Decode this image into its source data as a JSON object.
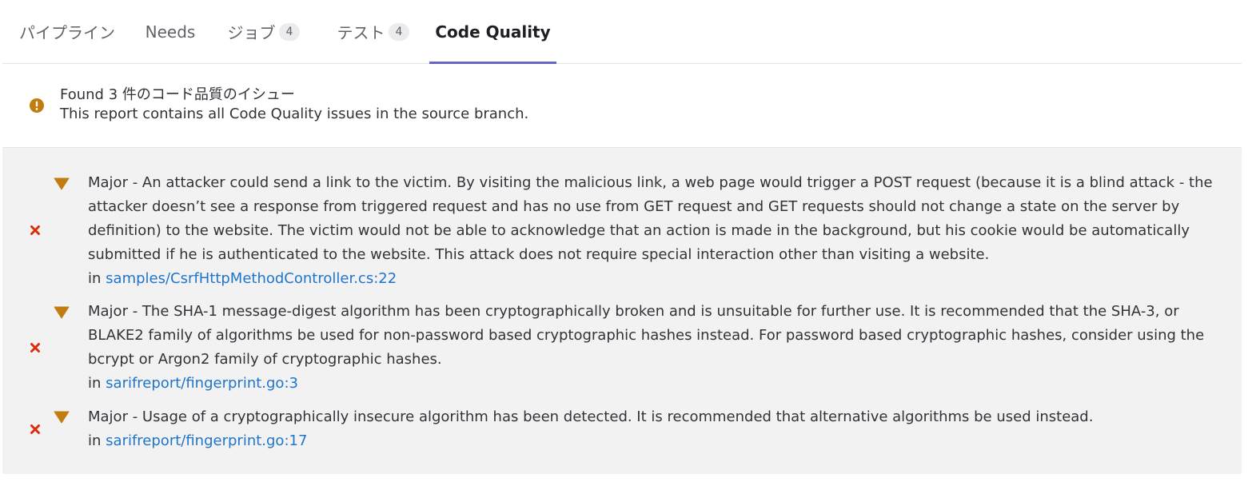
{
  "tabs": [
    {
      "label": "パイプライン"
    },
    {
      "label": "Needs"
    },
    {
      "label": "ジョブ",
      "count": "4"
    },
    {
      "label": "テスト",
      "count": "4"
    },
    {
      "label": "Code Quality"
    }
  ],
  "summary": {
    "icon": "warning-circle-icon",
    "title": "Found 3 件のコード品質のイシュー",
    "subtitle": "This report contains all Code Quality issues in the source branch."
  },
  "issues": [
    {
      "text": "Major - An attacker could send a link to the victim. By visiting the malicious link, a web page would trigger a POST request (because it is a blind attack - the attacker doesn’t see a response from triggered request and has no use from GET request and GET requests should not change a state on the server by definition) to the website. The victim would not be able to acknowledge that an action is made in the background, but his cookie would be automatically submitted if he is authenticated to the website. This attack does not require special interaction other than visiting a website.",
      "in_label": "in",
      "file": "samples/CsrfHttpMethodController.cs:22"
    },
    {
      "text": "Major - The SHA-1 message-digest algorithm has been cryptographically broken and is unsuitable for further use. It is recommended that the SHA-3, or BLAKE2 family of algorithms be used for non-password based cryptographic hashes instead. For password based cryptographic hashes, consider using the bcrypt or Argon2 family of cryptographic hashes.",
      "in_label": "in",
      "file": "sarifreport/fingerprint.go:3"
    },
    {
      "text": "Major - Usage of a cryptographically insecure algorithm has been detected. It is recommended that alternative algorithms be used instead.",
      "in_label": "in",
      "file": "sarifreport/fingerprint.go:17"
    }
  ],
  "colors": {
    "accent": "#6666c4",
    "link": "#1f75cb",
    "warning": "#c17d10",
    "severity_major": "#c17d10",
    "failed": "#dd2b0e"
  }
}
